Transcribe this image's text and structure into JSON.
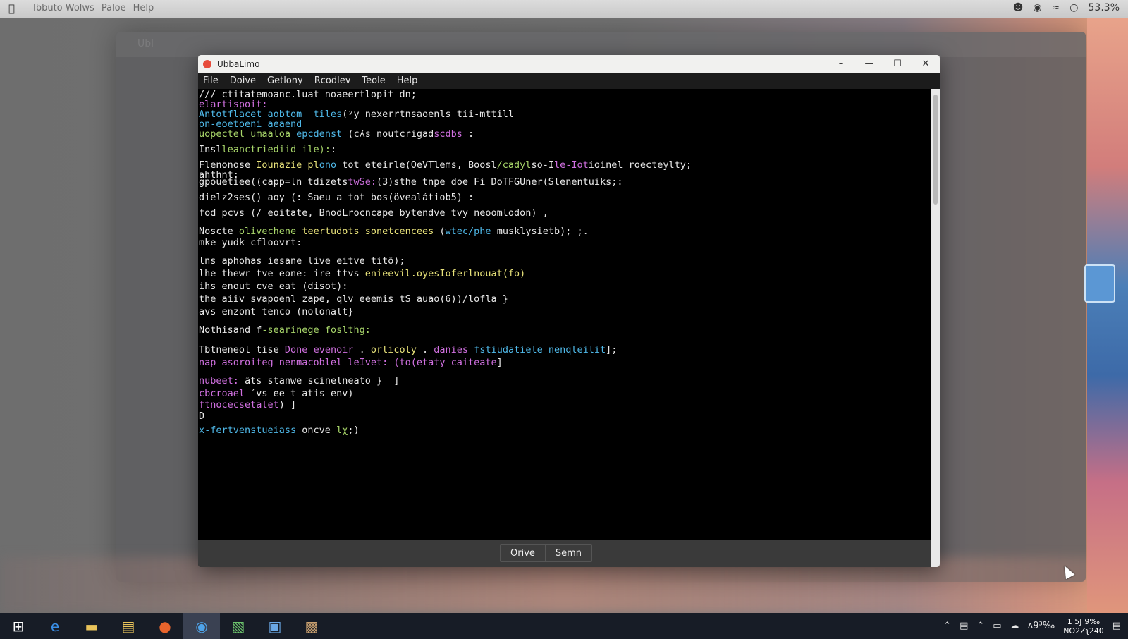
{
  "menubar": {
    "items": [
      "Ibbuto Wolws",
      "Paloe",
      "Help"
    ],
    "status_text": "53.3%"
  },
  "window": {
    "title": "UbbaLimo",
    "menu": [
      "File",
      "Doive",
      "Getlony",
      "Rcodlev",
      "Teole",
      "Help"
    ]
  },
  "editor": {
    "lines": [
      [
        [
          "c-white",
          "/// ctitatemoanc.luat noaeertlopit dn;"
        ]
      ],
      [
        [
          "c-pink",
          "elartispoit:"
        ]
      ],
      [
        [
          "c-cyan",
          "Antotflacet aobtom  tiles"
        ],
        [
          "c-white",
          "(ʸy nexerrtnsaoenls tii-mttill"
        ]
      ],
      [
        [
          "c-cyan",
          "on-eoetoeni aeaend"
        ]
      ],
      [
        [
          "c-green",
          "uopectel umaaloa"
        ],
        [
          "c-cyan",
          " epcdenst"
        ],
        [
          "c-white",
          " (¢ʎs noutcrigad"
        ],
        [
          "c-pink",
          "scdbs"
        ],
        [
          "c-white",
          " :"
        ]
      ],
      [],
      [
        [
          "c-white",
          "Insl"
        ],
        [
          "c-green",
          "leanctriediid ile):"
        ],
        [
          "c-white",
          ":"
        ]
      ],
      [
        [
          "c-white",
          "Flenonose"
        ],
        [
          "c-yellow",
          " Iounazie pl"
        ],
        [
          "c-cyan",
          "ono"
        ],
        [
          "c-white",
          " tot eteirle(OeVTlems, Boosl"
        ],
        [
          "c-green",
          "/cadyl"
        ],
        [
          "c-white",
          "so-I"
        ],
        [
          "c-pink",
          "le-Iot"
        ],
        [
          "c-white",
          "ioinel roecteylty;"
        ]
      ],
      [
        [
          "c-white",
          "ahthnt:"
        ]
      ],
      [
        [
          "c-white",
          "gpouetiee((capp=ln tdizets"
        ],
        [
          "c-pink",
          "twSe:"
        ],
        [
          "c-white",
          "(3)"
        ],
        [
          "c-white",
          "sthe tnpe doe Fi DoTFGUner(Slenentuiks;:"
        ]
      ],
      [
        [
          "c-white",
          "dielz2ses() aoy (: Saeu a tot bos(övealátiob5) :"
        ]
      ],
      [
        [
          "c-white",
          "fod pcvs (/ eoitate, BnodLrocncape bytendve tvy neoomlodon) ,"
        ]
      ],
      [],
      [
        [
          "c-white",
          "Noscte"
        ],
        [
          "c-green",
          " olivechene"
        ],
        [
          "c-yellow",
          " teertudots sonetcencees"
        ],
        [
          "c-white",
          " ("
        ],
        [
          "c-cyan",
          "wtec/phe"
        ],
        [
          "c-white",
          " musklysietb); ;."
        ]
      ],
      [
        [
          "c-white",
          "mke yudk cfloovrt:"
        ]
      ],
      [],
      [
        [
          "c-white",
          "lns aphohas iesane live eitve titö);"
        ]
      ],
      [
        [
          "c-white",
          "lhe thewr tve eone: ire ttvs "
        ],
        [
          "c-yellow",
          "enieevil.oyesIoferlnouat(fo)"
        ]
      ],
      [
        [
          "c-white",
          "ihs enout cve eat (disot):"
        ]
      ],
      [
        [
          "c-white",
          "the aiiv svapoenl zape, qlv eeemis tS auao(6))/lofla }"
        ]
      ],
      [
        [
          "c-white",
          "avs enzont tenco (nolonalt}"
        ]
      ],
      [],
      [
        [
          "c-white",
          "Nothisand f"
        ],
        [
          "c-green",
          "-searinege foslthg:"
        ]
      ],
      [],
      [
        [
          "c-white",
          "Tbtneneol tise"
        ],
        [
          "c-pink",
          " Done evenoir"
        ],
        [
          "c-white",
          " ."
        ],
        [
          "c-yellow",
          " orlicoly"
        ],
        [
          "c-white",
          " ."
        ],
        [
          "c-pink",
          " danies"
        ],
        [
          "c-cyan",
          " fstiudatiele nenqleilit"
        ],
        [
          "c-white",
          "];"
        ]
      ],
      [
        [
          "c-pink",
          "nap asoroiteg nenmacoblel leIvet:"
        ],
        [
          "c-white",
          " "
        ],
        [
          "c-pink",
          "(to(etaty caiteate"
        ],
        [
          "c-white",
          "]"
        ]
      ],
      [],
      [
        [
          "c-pink",
          "nubeet:"
        ],
        [
          "c-white",
          " äts stanwe scinelneato }  ]"
        ]
      ],
      [
        [
          "c-pink",
          "cbcroael"
        ],
        [
          "c-white",
          " ′vs ee t atis env)"
        ]
      ],
      [
        [
          "c-pink",
          "ftnocecsetalet"
        ],
        [
          "c-white",
          ") ]"
        ]
      ],
      [
        [
          "c-white",
          "D"
        ]
      ],
      [
        [
          "c-cyan",
          "x-fertvenstueiass"
        ],
        [
          "c-white",
          " oncve"
        ],
        [
          "c-green",
          " lχ"
        ],
        [
          "c-white",
          ";)"
        ]
      ]
    ],
    "line_tops": [
      0,
      14,
      28,
      42,
      56,
      0,
      78,
      100,
      114,
      124,
      146,
      168,
      0,
      194,
      210,
      0,
      236,
      254,
      272,
      290,
      308,
      0,
      334,
      0,
      362,
      380,
      0,
      406,
      424,
      440,
      456,
      476
    ]
  },
  "footer": {
    "buttons": [
      "Orive",
      "Semn"
    ]
  },
  "taskbar": {
    "apps": [
      {
        "name": "start-icon",
        "glyph": "⊞"
      },
      {
        "name": "edge-icon",
        "glyph": "e"
      },
      {
        "name": "folder-icon",
        "glyph": "▬"
      },
      {
        "name": "file-explorer-icon",
        "glyph": "▤"
      },
      {
        "name": "firefox-icon",
        "glyph": "●"
      },
      {
        "name": "browser-icon",
        "glyph": "◉"
      },
      {
        "name": "document-icon",
        "glyph": "▧"
      },
      {
        "name": "window-icon",
        "glyph": "▣"
      },
      {
        "name": "terminal-app-icon",
        "glyph": "▩"
      }
    ],
    "tray_text": "ʌ9³‰",
    "clock_line1": "1 5ʃ 9‰",
    "clock_line2": "NO2Zʅ240"
  }
}
